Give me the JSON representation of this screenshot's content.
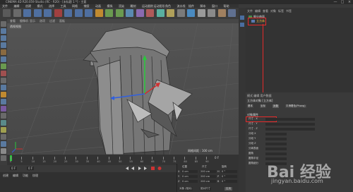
{
  "title": {
    "text": "CINEMA 4D R20.059 Studio (RC - R20) - [未标题 1 *] - 主要",
    "min": "—",
    "max": "□",
    "close": "×"
  },
  "menus": [
    "文件",
    "编辑",
    "创建",
    "模式",
    "选择",
    "工具",
    "网格",
    "捕捉",
    "动画",
    "模拟",
    "渲染",
    "雕刻",
    "运动跟踪",
    "运动图形",
    "角色",
    "流水线",
    "插件",
    "脚本",
    "窗口",
    "帮助"
  ],
  "viewport": {
    "menu": [
      "查看",
      "摄像机",
      "显示",
      "选项",
      "过滤",
      "面板"
    ],
    "label": "透视视图",
    "grid_label": "网格间距 : 100 cm"
  },
  "object_manager": {
    "menu": [
      "文件",
      "编辑",
      "查看",
      "对象",
      "标签",
      "书签"
    ],
    "items": [
      "立方体",
      "细分曲面"
    ]
  },
  "attributes": {
    "header": "模式  编辑  用户数据",
    "object_label": "立方体对象 [立方体]",
    "tabs": [
      "基本",
      "坐标",
      "对象",
      "平滑着色(Phong)"
    ],
    "section": "对象属性",
    "rows": [
      "尺寸 . X",
      "尺寸 . Y",
      "尺寸 . Z",
      "分段 X",
      "分段 Y",
      "分段 Z",
      "分离表面",
      "圆角",
      "圆角半径",
      "圆角细分"
    ]
  },
  "timeline": {
    "ticks": [
      "0",
      "5",
      "10",
      "15",
      "20",
      "25",
      "30",
      "35",
      "40",
      "45",
      "50",
      "55",
      "60",
      "65",
      "70",
      "75",
      "80",
      "85",
      "90"
    ],
    "current_frame": "0 F",
    "start": "0 F",
    "end": "90 F"
  },
  "material_menu": [
    "创建",
    "编辑",
    "功能",
    "纹理"
  ],
  "coordinates": {
    "headers": [
      "位置",
      "尺寸",
      "旋转"
    ],
    "rows": [
      {
        "axis": "X",
        "pos": "0 cm",
        "size": "200 cm",
        "rot_axis": "H",
        "rot": "0 °"
      },
      {
        "axis": "Y",
        "pos": "0 cm",
        "size": "200 cm",
        "rot_axis": "P",
        "rot": "0 °"
      },
      {
        "axis": "Z",
        "pos": "0 cm",
        "size": "200 cm",
        "rot_axis": "B",
        "rot": "0 °"
      }
    ],
    "mode": "对象 (相对)",
    "size_mode": "绝对尺寸",
    "apply": "应用"
  },
  "watermark": {
    "brand": "Bai 经验",
    "url": "jingyan.baidu.com"
  },
  "colors": {
    "accent_red": "#e32a2a",
    "axis_green": "#28c83a",
    "axis_red": "#d03030",
    "axis_blue": "#3060e0"
  }
}
